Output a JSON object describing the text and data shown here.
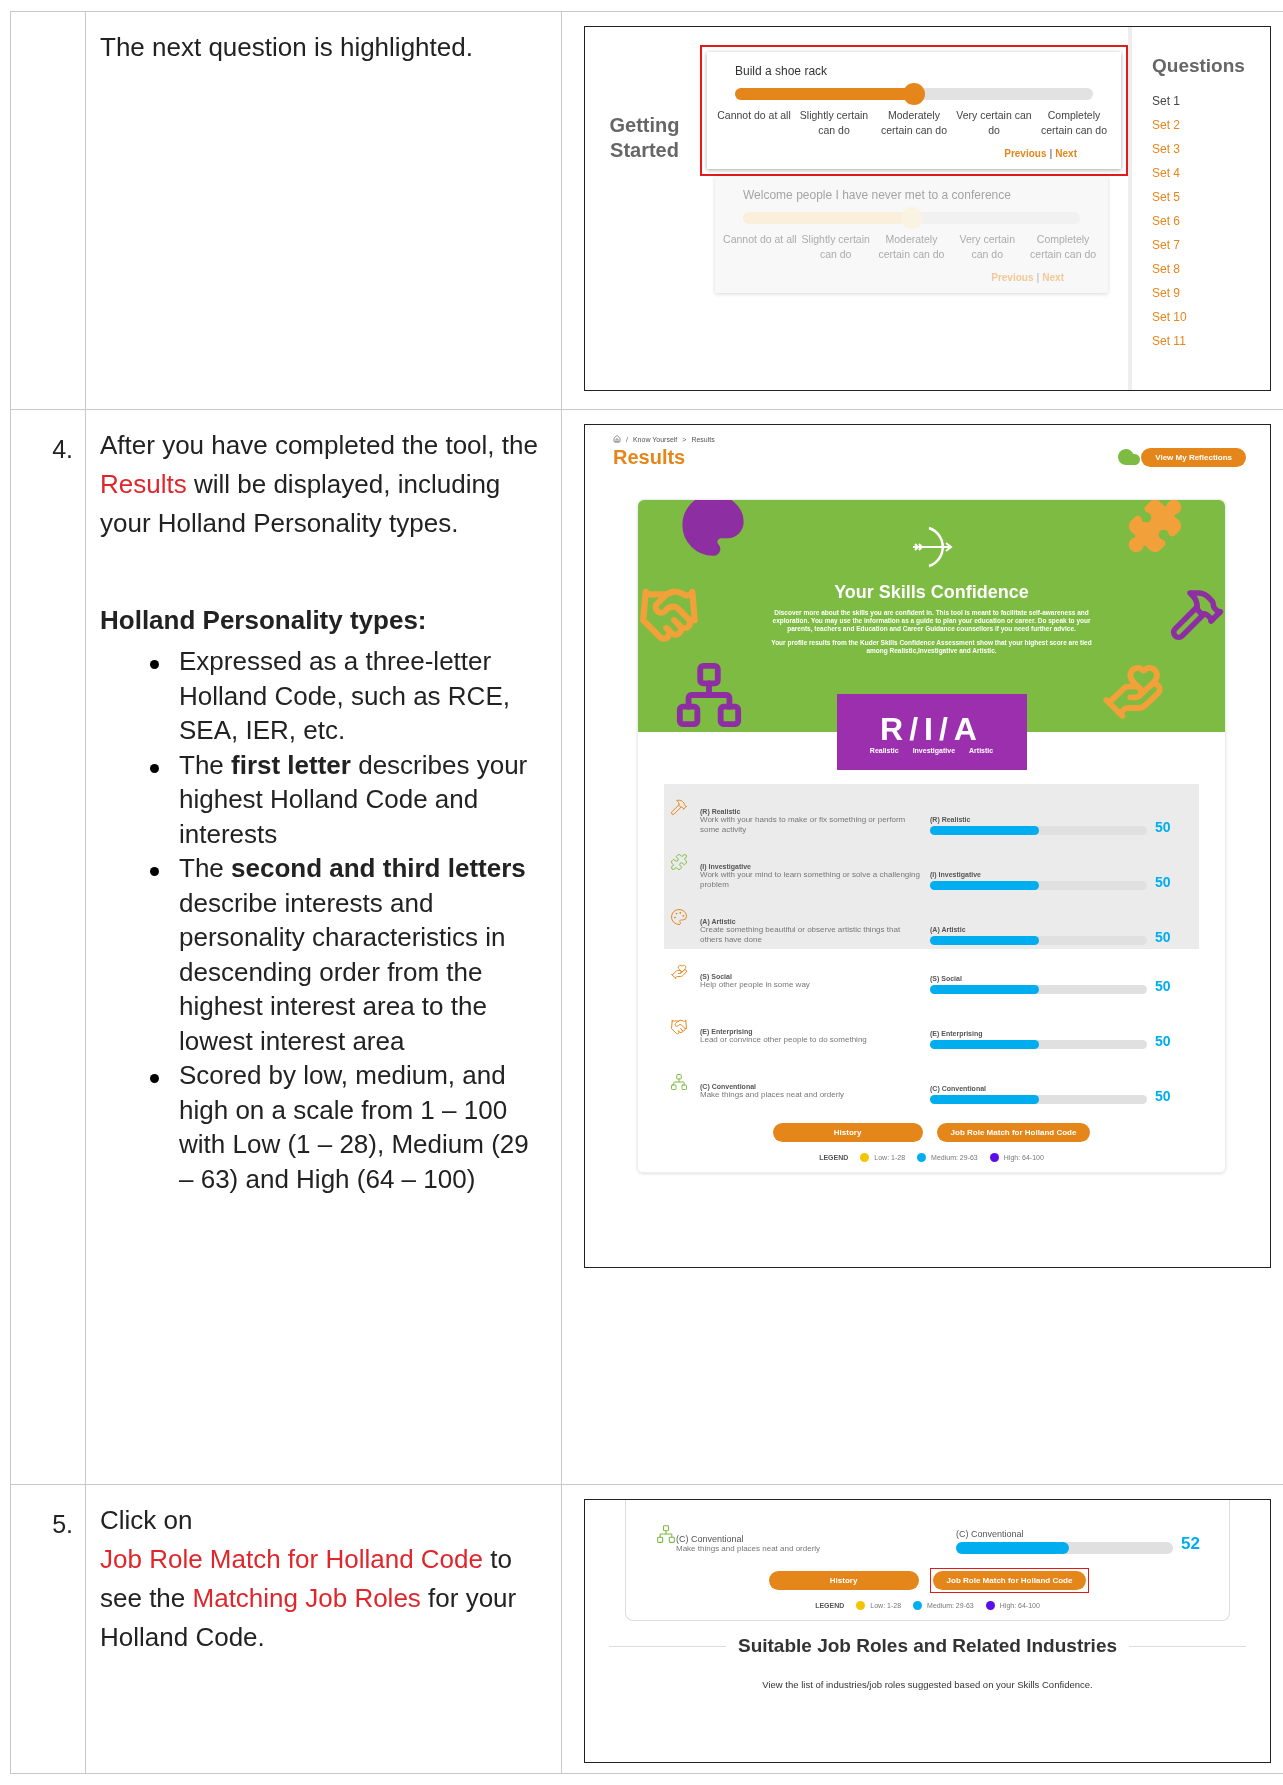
{
  "rows": [
    {
      "kind": "question",
      "segments": [
        {
          "text": "The next question is highlighted.",
          "highlight": false
        }
      ],
      "screenshot": {
        "heading": "Getting Started",
        "questions": [
          {
            "prompt": "Build a shoe rack",
            "highlighted": true,
            "level": 0.5,
            "options": [
              "Cannot do at all",
              "Slightly certain can do",
              "Moderately certain can do",
              "Very certain can do",
              "Completely certain can do"
            ],
            "previous": "Previous",
            "separator": "|",
            "next": "Next"
          },
          {
            "prompt": "Welcome people I have never met to a conference",
            "highlighted": false,
            "level": 0.5,
            "options": [
              "Cannot do at all",
              "Slightly certain can do",
              "Moderately certain can do",
              "Very certain can do",
              "Completely certain can do"
            ],
            "previous": "Previous",
            "separator": "|",
            "next": "Next"
          }
        ],
        "sidebar": {
          "title": "Questions",
          "sets": [
            {
              "label": "Set 1",
              "selected": true
            },
            {
              "label": "Set 2",
              "selected": false
            },
            {
              "label": "Set 3",
              "selected": false
            },
            {
              "label": "Set 4",
              "selected": false
            },
            {
              "label": "Set 5",
              "selected": false
            },
            {
              "label": "Set 6",
              "selected": false
            },
            {
              "label": "Set 7",
              "selected": false
            },
            {
              "label": "Set 8",
              "selected": false
            },
            {
              "label": "Set 9",
              "selected": false
            },
            {
              "label": "Set 10",
              "selected": false
            },
            {
              "label": "Set 11",
              "selected": false
            }
          ]
        }
      }
    },
    {
      "kind": "results",
      "number": "4.",
      "segments": [
        {
          "text": "After you have completed the tool, the ",
          "highlight": false
        },
        {
          "text": "Results",
          "highlight": true
        },
        {
          "text": " will be displayed, including your Holland Personality types.",
          "highlight": false
        }
      ],
      "section": {
        "heading": "Holland Personality types:",
        "bullets": [
          "Expressed as a three-letter Holland Code, such as RCE, SEA, IER, etc.",
          "The **first letter** describes your highest Holland Code and interests",
          "The **second and third letters** describe interests and personality characteristics in descending order from the highest interest area to the lowest interest area",
          "Scored by low, medium, and high on a scale from 1 – 100 with Low (1 – 28), Medium (29 – 63) and High (64 – 100)"
        ]
      },
      "screenshot": {
        "breadcrumb": [
          "/",
          "Know Yourself",
          ">",
          "Results"
        ],
        "title": "Results",
        "reflections_button": "View My Reflections",
        "banner": {
          "title": "Your Skills Confidence",
          "paragraphs": [
            "Discover more about the skills you are confident in. This tool is meant to facilitate self-awareness and exploration. You may use the information as a guide to plan your education or career. Do speak to your parents, teachers and Education and Career Guidance counsellors if you need further advice.",
            "Your profile results from the Kuder Skills Confidence Assessment show that your highest score are tied among Realistic,Investigative and Artistic."
          ],
          "code": "R/I/A",
          "code_labels": [
            "Realistic",
            "Investigative",
            "Artistic"
          ]
        },
        "scores": [
          {
            "kind": "realistic",
            "name": "(R) Realistic",
            "description": "Work with your hands to make or fix something or perform some activity",
            "bar_label": "(R) Realistic",
            "level": 0.5,
            "value": "50",
            "highlighted": true
          },
          {
            "kind": "investigative",
            "name": "(I) Investigative",
            "description": "Work with your mind to learn something or solve a challenging problem",
            "bar_label": "(I) Investigative",
            "level": 0.5,
            "value": "50",
            "highlighted": true
          },
          {
            "kind": "artistic",
            "name": "(A) Artistic",
            "description": "Create something beautiful or observe artistic things that others have done",
            "bar_label": "(A) Artistic",
            "level": 0.5,
            "value": "50",
            "highlighted": true
          },
          {
            "kind": "social",
            "name": "(S) Social",
            "description": "Help other people in some way",
            "bar_label": "(S) Social",
            "level": 0.5,
            "value": "50",
            "highlighted": false
          },
          {
            "kind": "enterprising",
            "name": "(E) Enterprising",
            "description": "Lead or convince other people to do something",
            "bar_label": "(E) Enterprising",
            "level": 0.5,
            "value": "50",
            "highlighted": false
          },
          {
            "kind": "conventional",
            "name": "(C) Conventional",
            "description": "Make things and places neat and orderly",
            "bar_label": "(C) Conventional",
            "level": 0.5,
            "value": "50",
            "highlighted": false
          }
        ],
        "buttons": [
          {
            "label": "History",
            "outlined": false
          },
          {
            "label": "Job Role Match for Holland Code",
            "outlined": false
          }
        ],
        "legend": {
          "title": "LEGEND",
          "items": [
            {
              "label": "Low: 1-28",
              "color": "#f5c400"
            },
            {
              "label": "Medium: 29-63",
              "color": "#00aeef"
            },
            {
              "label": "High: 64-100",
              "color": "#5b0ee6"
            }
          ]
        }
      }
    },
    {
      "kind": "job_match",
      "number": "5.",
      "segments": [
        {
          "text": "Click on ",
          "highlight": false
        },
        {
          "text": "Job Role Match for Holland Code",
          "highlight": true
        },
        {
          "text": " to see the ",
          "highlight": false
        },
        {
          "text": "Matching Job Roles",
          "highlight": true
        },
        {
          "text": " for your Holland Code.",
          "highlight": false
        }
      ],
      "screenshot": {
        "scores": [
          {
            "kind": "conventional",
            "name": "(C) Conventional",
            "description": "Make things and places neat and orderly",
            "bar_label": "(C) Conventional",
            "level": 0.52,
            "value": "52",
            "highlighted": false
          }
        ],
        "buttons": [
          {
            "label": "History",
            "outlined": false
          },
          {
            "label": "Job Role Match for Holland Code",
            "outlined": true
          }
        ],
        "legend": {
          "title": "LEGEND",
          "items": [
            {
              "label": "Low: 1-28",
              "color": "#f5c400"
            },
            {
              "label": "Medium: 29-63",
              "color": "#00aeef"
            },
            {
              "label": "High: 64-100",
              "color": "#5b0ee6"
            }
          ]
        },
        "heading": "Suitable Job Roles and Related Industries",
        "text": "View the list of industries/job roles suggested based on your Skills Confidence."
      }
    }
  ]
}
